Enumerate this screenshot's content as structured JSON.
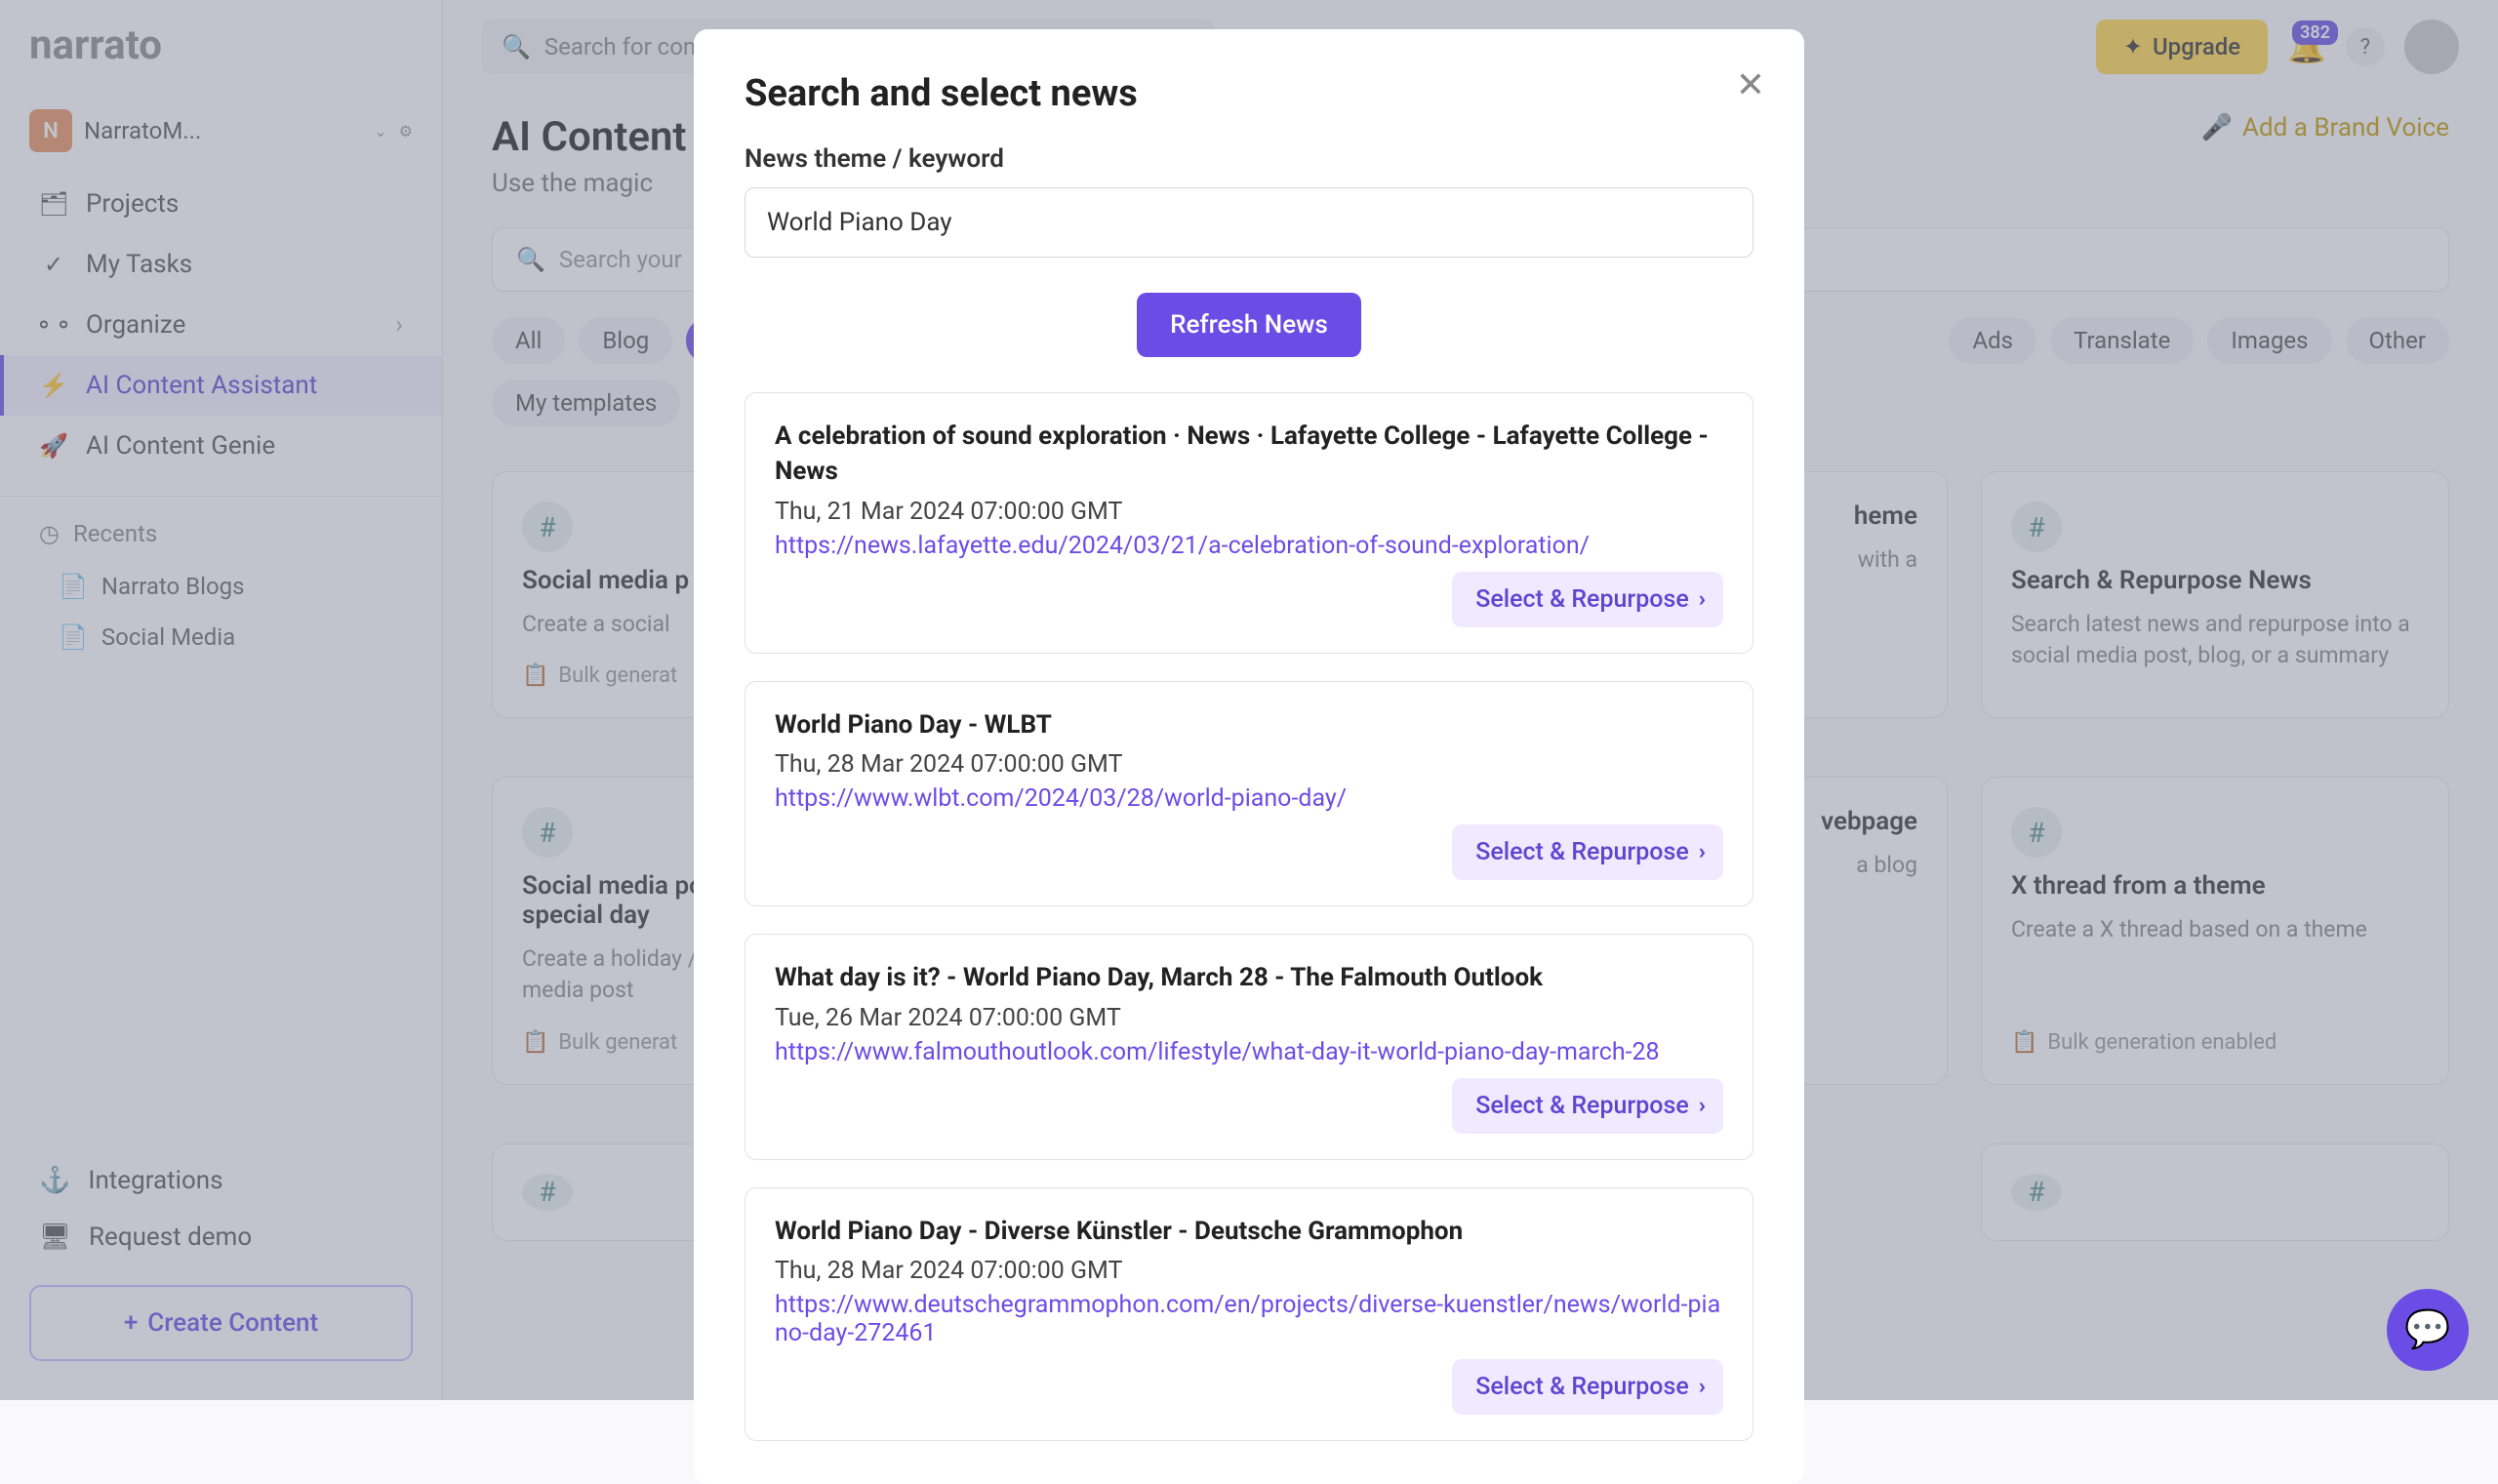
{
  "workspace": {
    "badge": "N",
    "name": "NarratoM..."
  },
  "nav": {
    "projects": "Projects",
    "my_tasks": "My Tasks",
    "organize": "Organize",
    "ai_assistant": "AI Content Assistant",
    "ai_genie": "AI Content Genie"
  },
  "recents": {
    "header": "Recents",
    "items": [
      "Narrato Blogs",
      "Social Media"
    ]
  },
  "bottom": {
    "integrations": "Integrations",
    "request_demo": "Request demo",
    "create": "Create Content"
  },
  "topbar": {
    "search_placeholder": "Search for content, projects, folders and people",
    "upgrade": "Upgrade",
    "badge": "382"
  },
  "page": {
    "title": "AI Content",
    "subtitle": "Use the magic",
    "brand_voice": "Add a Brand Voice",
    "ai_search_placeholder": "Search your"
  },
  "pills": {
    "row1": [
      "All",
      "Blog",
      "",
      "",
      "",
      "",
      "",
      "",
      "",
      "",
      "Ads",
      "Translate",
      "Images",
      "Other"
    ],
    "row2": [
      "My templates"
    ]
  },
  "cards": [
    {
      "title": "Social media p",
      "desc": "Create a social",
      "footer": "Bulk generat"
    },
    {
      "title": "heme",
      "desc": "with a",
      "footer": ""
    },
    {
      "title": "Search & Repurpose News",
      "desc": "Search latest news and repurpose into a social media post, blog, or a summary",
      "footer": ""
    },
    {
      "title": "Social media post for a holiday / special day",
      "desc": "Create a holiday / special day social media post",
      "footer": "Bulk generat"
    },
    {
      "title": "vebpage",
      "desc": "a blog",
      "footer": ""
    },
    {
      "title": "X thread from a theme",
      "desc": "Create a X thread based on a theme",
      "footer": "Bulk generation enabled"
    }
  ],
  "modal": {
    "title": "Search and select news",
    "field_label": "News theme / keyword",
    "input_value": "World Piano Day",
    "refresh": "Refresh News",
    "select_label": "Select & Repurpose",
    "news": [
      {
        "title": "A celebration of sound exploration · News · Lafayette College - Lafayette College - News",
        "date": "Thu, 21 Mar 2024 07:00:00 GMT",
        "link": "https://news.lafayette.edu/2024/03/21/a-celebration-of-sound-exploration/"
      },
      {
        "title": "World Piano Day - WLBT",
        "date": "Thu, 28 Mar 2024 07:00:00 GMT",
        "link": "https://www.wlbt.com/2024/03/28/world-piano-day/"
      },
      {
        "title": "What day is it? - World Piano Day, March 28 - The Falmouth Outlook",
        "date": "Tue, 26 Mar 2024 07:00:00 GMT",
        "link": "https://www.falmouthoutlook.com/lifestyle/what-day-it-world-piano-day-march-28"
      },
      {
        "title": "World Piano Day - Diverse Künstler - Deutsche Grammophon",
        "date": "Thu, 28 Mar 2024 07:00:00 GMT",
        "link": "https://www.deutschegrammophon.com/en/projects/diverse-kuenstler/news/world-piano-day-272461"
      }
    ]
  }
}
